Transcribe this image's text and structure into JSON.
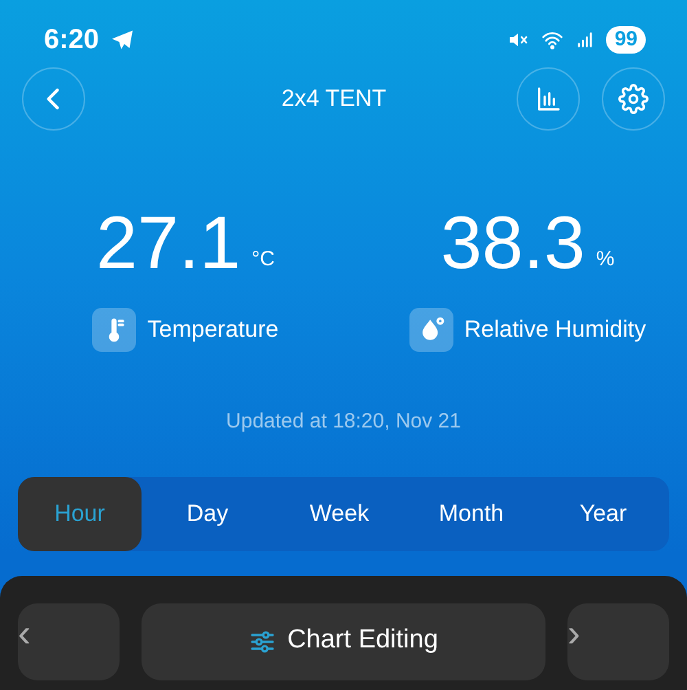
{
  "status_bar": {
    "time": "6:20",
    "battery": "99"
  },
  "header": {
    "title": "2x4 TENT"
  },
  "readings": [
    {
      "kind": "temperature",
      "value": "27.1",
      "unit": "°C",
      "label": "Temperature"
    },
    {
      "kind": "humidity",
      "value": "38.3",
      "unit": "%",
      "label": "Relative Humidity"
    }
  ],
  "updated": "Updated at 18:20, Nov 21",
  "tabs": [
    {
      "label": "Hour",
      "selected": true
    },
    {
      "label": "Day",
      "selected": false
    },
    {
      "label": "Week",
      "selected": false
    },
    {
      "label": "Month",
      "selected": false
    },
    {
      "label": "Year",
      "selected": false
    }
  ],
  "chart_controls": {
    "prev": "‹",
    "edit": "Chart Editing",
    "next": "›"
  }
}
